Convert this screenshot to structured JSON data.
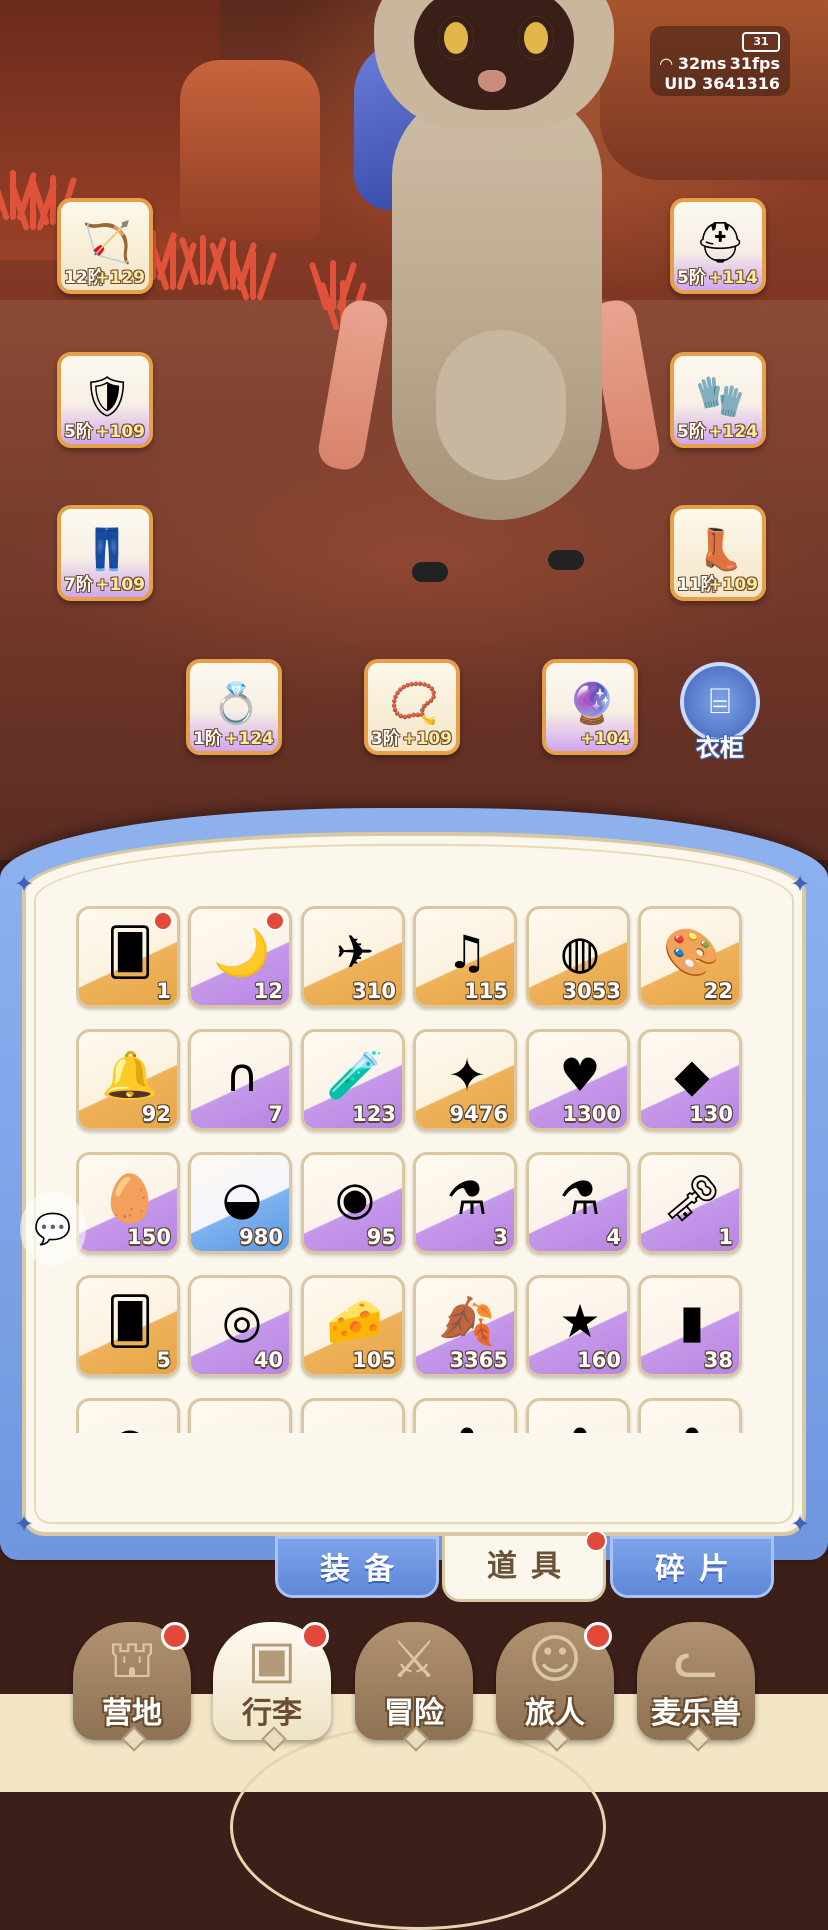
{
  "hud": {
    "battery": "31",
    "ping": "32ms",
    "fps": "31fps",
    "uid": "UID 3641316"
  },
  "equipment": {
    "left": [
      {
        "tier": "12阶",
        "plus": "+129",
        "icon": "bow-icon",
        "rarity": "gold"
      },
      {
        "tier": "5阶",
        "plus": "+109",
        "icon": "armor-icon",
        "rarity": "purple"
      },
      {
        "tier": "7阶",
        "plus": "+109",
        "icon": "leg-armor-icon",
        "rarity": "purple"
      }
    ],
    "right": [
      {
        "tier": "5阶",
        "plus": "+114",
        "icon": "helmet-icon",
        "rarity": "purple"
      },
      {
        "tier": "5阶",
        "plus": "+124",
        "icon": "gauntlet-icon",
        "rarity": "purple"
      },
      {
        "tier": "11阶",
        "plus": "+109",
        "icon": "boots-icon",
        "rarity": "gold"
      }
    ],
    "accessories": [
      {
        "tier": "1阶",
        "plus": "+124",
        "icon": "ring-icon",
        "rarity": "purple"
      },
      {
        "tier": "3阶",
        "plus": "+109",
        "icon": "necklace-icon",
        "rarity": "gold"
      },
      {
        "tier": "",
        "plus": "+104",
        "icon": "charm-icon",
        "rarity": "purple"
      }
    ],
    "wardrobe_label": "衣柜"
  },
  "inventory": {
    "rows": [
      [
        {
          "count": "1",
          "rarity": "gold",
          "icon": "gold-card-icon",
          "glyph": "🂠",
          "badge": true
        },
        {
          "count": "12",
          "rarity": "purple",
          "icon": "moon-card-icon",
          "glyph": "🌙",
          "badge": true
        },
        {
          "count": "310",
          "rarity": "gold",
          "icon": "paper-plane-icon",
          "glyph": "✈",
          "badge": false
        },
        {
          "count": "115",
          "rarity": "gold",
          "icon": "lyre-icon",
          "glyph": "♫",
          "badge": false
        },
        {
          "count": "3053",
          "rarity": "gold",
          "icon": "crystal-orb-icon",
          "glyph": "◍",
          "badge": false
        },
        {
          "count": "22",
          "rarity": "gold",
          "icon": "rainbow-paint-icon",
          "glyph": "🎨",
          "badge": false
        }
      ],
      [
        {
          "count": "92",
          "rarity": "gold",
          "icon": "bell-icon",
          "glyph": "🔔",
          "badge": false
        },
        {
          "count": "7",
          "rarity": "purple",
          "icon": "horseshoe-icon",
          "glyph": "∩",
          "badge": false
        },
        {
          "count": "123",
          "rarity": "purple",
          "icon": "potion-bottle-icon",
          "glyph": "🧪",
          "badge": false
        },
        {
          "count": "9476",
          "rarity": "gold",
          "icon": "star-crystal-icon",
          "glyph": "✦",
          "badge": false
        },
        {
          "count": "1300",
          "rarity": "purple",
          "icon": "heart-icon",
          "glyph": "♥",
          "badge": false
        },
        {
          "count": "130",
          "rarity": "purple",
          "icon": "purple-gem-icon",
          "glyph": "◆",
          "badge": false
        }
      ],
      [
        {
          "count": "150",
          "rarity": "purple",
          "icon": "golden-egg-icon",
          "glyph": "🥚",
          "badge": false
        },
        {
          "count": "980",
          "rarity": "blue",
          "icon": "fur-bowl-icon",
          "glyph": "◒",
          "badge": false
        },
        {
          "count": "95",
          "rarity": "purple",
          "icon": "heart-coin-icon",
          "glyph": "◉",
          "badge": false
        },
        {
          "count": "3",
          "rarity": "purple",
          "icon": "blue-potion-icon",
          "glyph": "⚗",
          "badge": false
        },
        {
          "count": "4",
          "rarity": "purple",
          "icon": "red-potion-icon",
          "glyph": "⚗",
          "badge": false
        },
        {
          "count": "1",
          "rarity": "purple",
          "icon": "golden-key-icon",
          "glyph": "🗝",
          "badge": false
        }
      ],
      [
        {
          "count": "5",
          "rarity": "gold",
          "icon": "gold-card-icon",
          "glyph": "🂠",
          "badge": false
        },
        {
          "count": "40",
          "rarity": "purple",
          "icon": "cat-eye-icon",
          "glyph": "◎",
          "badge": false
        },
        {
          "count": "105",
          "rarity": "gold",
          "icon": "cheese-icon",
          "glyph": "🧀",
          "badge": false
        },
        {
          "count": "3365",
          "rarity": "purple",
          "icon": "golden-leaf-icon",
          "glyph": "🍂",
          "badge": false
        },
        {
          "count": "160",
          "rarity": "purple",
          "icon": "star-cookie-icon",
          "glyph": "★",
          "badge": false
        },
        {
          "count": "38",
          "rarity": "purple",
          "icon": "paint-tube-icon",
          "glyph": "▮",
          "badge": false
        }
      ],
      [
        {
          "count": "",
          "rarity": "purple",
          "icon": "blue-slime-icon",
          "glyph": "●",
          "badge": false
        },
        {
          "count": "",
          "rarity": "purple",
          "icon": "ticket-icon",
          "glyph": "▭",
          "badge": false
        },
        {
          "count": "",
          "rarity": "purple",
          "icon": "book-icon",
          "glyph": "▬",
          "badge": false
        },
        {
          "count": "",
          "rarity": "purple",
          "icon": "blue-flower-icon",
          "glyph": "✿",
          "badge": false
        },
        {
          "count": "",
          "rarity": "purple",
          "icon": "purple-flower-icon",
          "glyph": "✿",
          "badge": false
        },
        {
          "count": "",
          "rarity": "purple",
          "icon": "yellow-flower-icon",
          "glyph": "✿",
          "badge": false
        }
      ]
    ]
  },
  "category_tabs": [
    {
      "label": "装备",
      "active": false,
      "badge": false
    },
    {
      "label": "道具",
      "active": true,
      "badge": true
    },
    {
      "label": "碎片",
      "active": false,
      "badge": false
    }
  ],
  "nav": [
    {
      "label": "营地",
      "icon": "castle-icon",
      "glyph": "⛫",
      "active": false,
      "badge": true
    },
    {
      "label": "行李",
      "icon": "backpack-icon",
      "glyph": "▣",
      "active": true,
      "badge": true
    },
    {
      "label": "冒险",
      "icon": "crossed-swords-icon",
      "glyph": "⚔",
      "active": false,
      "badge": false
    },
    {
      "label": "旅人",
      "icon": "traveler-icon",
      "glyph": "☺",
      "active": false,
      "badge": true
    },
    {
      "label": "麦乐兽",
      "icon": "cat-companion-icon",
      "glyph": "ᓚ",
      "active": false,
      "badge": false
    }
  ],
  "colors": {
    "panel_blue": "#7ea3ea",
    "panel_cream": "#fbf7ec",
    "gold_rarity": "#eeb25a",
    "purple_rarity": "#c598ea",
    "blue_rarity": "#7eb2ef",
    "badge_red": "#e2493a"
  }
}
